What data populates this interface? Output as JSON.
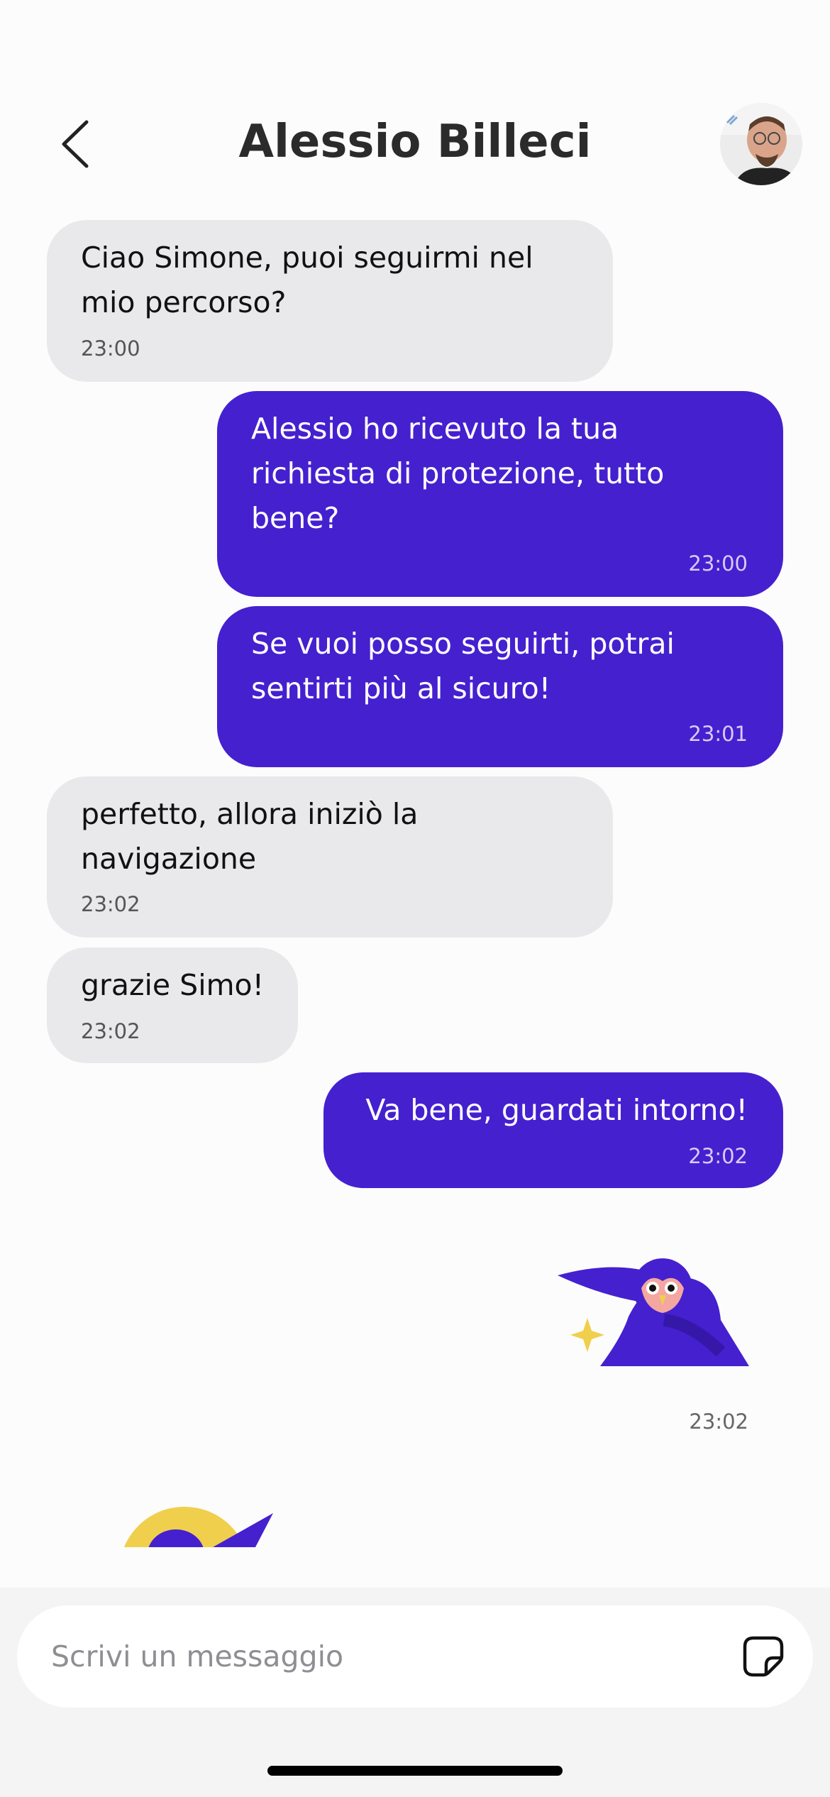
{
  "header": {
    "title": "Alessio Billeci",
    "back_icon": "chevron-left-icon",
    "avatar_icon": "avatar"
  },
  "messages": [
    {
      "direction": "in",
      "text": "Ciao Simone, puoi seguirmi nel\nmio percorso?",
      "time": "23:00"
    },
    {
      "direction": "out",
      "text": "Alessio ho ricevuto la tua\nrichiesta di protezione, tutto\nbene?",
      "time": "23:00"
    },
    {
      "direction": "out",
      "text": "Se vuoi posso seguirti, potrai\nsentirti più al sicuro!",
      "time": "23:01"
    },
    {
      "direction": "in",
      "text": "perfetto, allora iniziò la\nnavigazione",
      "time": "23:02"
    },
    {
      "direction": "in",
      "text": "grazie Simo!",
      "time": "23:02"
    },
    {
      "direction": "out",
      "text": "Va bene, guardati intorno!",
      "time": "23:02"
    }
  ],
  "sticker_message": {
    "icon": "owl-sticker-icon",
    "time": "23:02"
  },
  "composer": {
    "placeholder": "Scrivi un messaggio",
    "sticker_icon": "sticker-icon"
  },
  "colors": {
    "outgoing_bubble": "#4520cf",
    "incoming_bubble": "#e9e9eb",
    "accent_yellow": "#f0cf4d"
  }
}
